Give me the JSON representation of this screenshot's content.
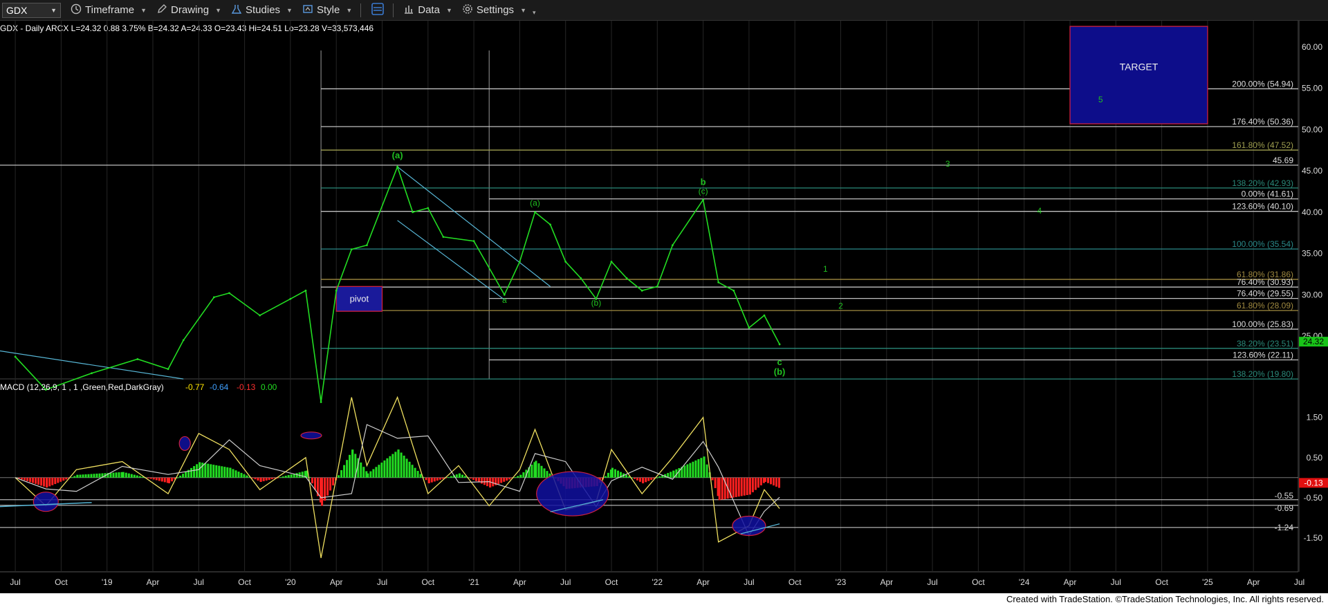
{
  "toolbar": {
    "symbol": "GDX",
    "items": [
      {
        "label": "Timeframe",
        "icon": "clock-icon"
      },
      {
        "label": "Drawing",
        "icon": "pen-icon"
      },
      {
        "label": "Studies",
        "icon": "flask-icon"
      },
      {
        "label": "Style",
        "icon": "style-icon"
      },
      {
        "label": "Data",
        "icon": "bar-chart-icon"
      },
      {
        "label": "Settings",
        "icon": "gear-icon"
      }
    ]
  },
  "header": {
    "prefix": "GDX - Daily  ARCX  ",
    "quote": "L=24.32  0.88  3.75%  B=24.32  A=24.33  O=23.43  Hi=24.51  Lo=23.28  V=33,573,446"
  },
  "macd_header": {
    "label": "MACD (12,26,9, 1 , 1 ,Green,Red,DarkGray)",
    "v1": "-0.77",
    "v2": "-0.64",
    "v3": "-0.13",
    "v4": "0.00"
  },
  "footer": "Created with TradeStation. ©TradeStation Technologies, Inc. All rights reserved.",
  "colors": {
    "price": "#22dd22",
    "up": "#22dd22",
    "down": "#ff2020",
    "target_box": "#0d0d8a",
    "pivot_box": "#1a1a9a",
    "label": "#20c020",
    "axis_text": "#dddddd",
    "last_price_badge": "#18c418"
  },
  "chart_data": {
    "type": "line",
    "title": "GDX - Daily",
    "price_axis": {
      "min": 20,
      "max": 60,
      "ticks": [
        "60.00",
        "55.00",
        "50.00",
        "45.00",
        "40.00",
        "35.00",
        "30.00",
        "25.00"
      ]
    },
    "last_price": "24.32",
    "time_axis": {
      "labels": [
        "Jul",
        "Oct",
        "'19",
        "Apr",
        "Jul",
        "Oct",
        "'20",
        "Apr",
        "Jul",
        "Oct",
        "'21",
        "Apr",
        "Jul",
        "Oct",
        "'22",
        "Apr",
        "Jul",
        "Oct",
        "'23",
        "Apr",
        "Jul",
        "Oct",
        "'24",
        "Apr",
        "Jul",
        "Oct",
        "'25",
        "Apr",
        "Jul"
      ]
    },
    "price_series": [
      {
        "t": "2018-07",
        "v": 22.5
      },
      {
        "t": "2018-09",
        "v": 18.5
      },
      {
        "t": "2018-12",
        "v": 20.5
      },
      {
        "t": "2019-03",
        "v": 22.2
      },
      {
        "t": "2019-05",
        "v": 21.0
      },
      {
        "t": "2019-06",
        "v": 24.5
      },
      {
        "t": "2019-08",
        "v": 29.7
      },
      {
        "t": "2019-09",
        "v": 30.2
      },
      {
        "t": "2019-11",
        "v": 27.5
      },
      {
        "t": "2020-01",
        "v": 29.5
      },
      {
        "t": "2020-02",
        "v": 30.5
      },
      {
        "t": "2020-03",
        "v": 17.0
      },
      {
        "t": "2020-04",
        "v": 30.5
      },
      {
        "t": "2020-05",
        "v": 35.5
      },
      {
        "t": "2020-06",
        "v": 36.0
      },
      {
        "t": "2020-08",
        "v": 45.5
      },
      {
        "t": "2020-09",
        "v": 40.0
      },
      {
        "t": "2020-10",
        "v": 40.5
      },
      {
        "t": "2020-11",
        "v": 37.0
      },
      {
        "t": "2021-01",
        "v": 36.5
      },
      {
        "t": "2021-03",
        "v": 30.0
      },
      {
        "t": "2021-04",
        "v": 34.0
      },
      {
        "t": "2021-05",
        "v": 40.0
      },
      {
        "t": "2021-06",
        "v": 38.5
      },
      {
        "t": "2021-07",
        "v": 34.0
      },
      {
        "t": "2021-08",
        "v": 32.0
      },
      {
        "t": "2021-09",
        "v": 29.5
      },
      {
        "t": "2021-10",
        "v": 34.0
      },
      {
        "t": "2021-11",
        "v": 32.0
      },
      {
        "t": "2021-12",
        "v": 30.5
      },
      {
        "t": "2022-01",
        "v": 31.0
      },
      {
        "t": "2022-02",
        "v": 36.0
      },
      {
        "t": "2022-04",
        "v": 41.5
      },
      {
        "t": "2022-05",
        "v": 31.5
      },
      {
        "t": "2022-06",
        "v": 30.5
      },
      {
        "t": "2022-07",
        "v": 26.0
      },
      {
        "t": "2022-08",
        "v": 27.5
      },
      {
        "t": "2022-09",
        "v": 24.0
      }
    ],
    "levels": [
      {
        "label": "200.00% (54.94)",
        "value": 54.94,
        "color": "#c0c0c0",
        "start": "2020-03"
      },
      {
        "label": "176.40% (50.36)",
        "value": 50.36,
        "color": "#c0c0c0",
        "start": "2020-03"
      },
      {
        "label": "161.80% (47.52)",
        "value": 47.52,
        "color": "#a0a050",
        "start": "2020-03"
      },
      {
        "label": "45.69",
        "value": 45.69,
        "color": "#c0c0c0",
        "start": "2018-06"
      },
      {
        "label": "138.20% (42.93)",
        "value": 42.93,
        "color": "#2a8a7a",
        "start": "2020-03"
      },
      {
        "label": "0.00% (41.61)",
        "value": 41.61,
        "color": "#c0c0c0",
        "start": "2021-02"
      },
      {
        "label": "123.60% (40.10)",
        "value": 40.1,
        "color": "#c0c0c0",
        "start": "2020-03"
      },
      {
        "label": "100.00% (35.54)",
        "value": 35.54,
        "color": "#2a8a8a",
        "start": "2020-03"
      },
      {
        "label": "61.80% (31.86)",
        "value": 31.86,
        "color": "#a08a40",
        "start": "2020-03"
      },
      {
        "label": "76.40% (30.93)",
        "value": 30.93,
        "color": "#c0c0c0",
        "start": "2020-03"
      },
      {
        "label": "76.40% (29.55)",
        "value": 29.55,
        "color": "#c0c0c0",
        "start": "2021-02"
      },
      {
        "label": "61.80% (28.09)",
        "value": 28.09,
        "color": "#a08a40",
        "start": "2020-04"
      },
      {
        "label": "100.00% (25.83)",
        "value": 25.83,
        "color": "#c0c0c0",
        "start": "2021-02"
      },
      {
        "label": "38.20% (23.51)",
        "value": 23.51,
        "color": "#2a8a7a",
        "start": "2020-03"
      },
      {
        "label": "123.60% (22.11)",
        "value": 22.11,
        "color": "#c0c0c0",
        "start": "2021-02"
      },
      {
        "label": "138.20% (19.80)",
        "value": 19.8,
        "color": "#2a8a7a",
        "start": "2020-03"
      }
    ],
    "wave_labels": [
      {
        "text": "(a)",
        "t": "2020-08",
        "v": 46.5
      },
      {
        "text": "a",
        "t": "2021-03",
        "v": 29.0
      },
      {
        "text": "(a)",
        "t": "2021-05",
        "v": 40.8
      },
      {
        "text": "(b)",
        "t": "2021-09",
        "v": 28.7
      },
      {
        "text": "(c)",
        "t": "2022-04",
        "v": 42.2
      },
      {
        "text": "b",
        "t": "2022-04",
        "v": 43.3
      },
      {
        "text": "c",
        "t": "2022-09",
        "v": 21.5
      },
      {
        "text": "(b)",
        "t": "2022-09",
        "v": 20.3
      },
      {
        "text": "1",
        "t": "2022-12",
        "v": 32.8
      },
      {
        "text": "2",
        "t": "2023-01",
        "v": 28.3
      },
      {
        "text": "3",
        "t": "2023-08",
        "v": 45.5
      },
      {
        "text": "4",
        "t": "2024-02",
        "v": 39.8
      },
      {
        "text": "5",
        "t": "2024-06",
        "v": 53.3
      }
    ],
    "boxes": [
      {
        "label": "TARGET",
        "from": "2024-04",
        "to": "2025-01",
        "hi": 62.5,
        "lo": 50.7
      },
      {
        "label": "pivot",
        "from": "2020-04",
        "to": "2020-07",
        "hi": 31.0,
        "lo": 28.0
      }
    ],
    "macd": {
      "axis": {
        "ticks": [
          "1.50",
          "0.50",
          "-0.50",
          "-1.50"
        ],
        "min": -2,
        "max": 2.2
      },
      "labels": [
        "-0.55",
        "-0.69",
        "-1.24",
        "-0.13"
      ],
      "series": [
        {
          "t": "2018-07",
          "v": 0.0
        },
        {
          "t": "2018-09",
          "v": -0.7
        },
        {
          "t": "2018-11",
          "v": 0.2
        },
        {
          "t": "2019-02",
          "v": 0.4
        },
        {
          "t": "2019-05",
          "v": -0.4
        },
        {
          "t": "2019-07",
          "v": 1.1
        },
        {
          "t": "2019-09",
          "v": 0.7
        },
        {
          "t": "2019-11",
          "v": -0.3
        },
        {
          "t": "2020-02",
          "v": 0.5
        },
        {
          "t": "2020-03",
          "v": -2.0
        },
        {
          "t": "2020-05",
          "v": 2.0
        },
        {
          "t": "2020-06",
          "v": 0.3
        },
        {
          "t": "2020-08",
          "v": 2.0
        },
        {
          "t": "2020-10",
          "v": -0.4
        },
        {
          "t": "2020-12",
          "v": 0.3
        },
        {
          "t": "2021-02",
          "v": -0.7
        },
        {
          "t": "2021-04",
          "v": 0.2
        },
        {
          "t": "2021-05",
          "v": 1.2
        },
        {
          "t": "2021-07",
          "v": -0.8
        },
        {
          "t": "2021-09",
          "v": -0.6
        },
        {
          "t": "2021-10",
          "v": 0.7
        },
        {
          "t": "2021-12",
          "v": -0.4
        },
        {
          "t": "2022-02",
          "v": 0.5
        },
        {
          "t": "2022-04",
          "v": 1.5
        },
        {
          "t": "2022-05",
          "v": -1.6
        },
        {
          "t": "2022-07",
          "v": -1.2
        },
        {
          "t": "2022-08",
          "v": -0.3
        },
        {
          "t": "2022-09",
          "v": -0.77
        }
      ]
    }
  }
}
